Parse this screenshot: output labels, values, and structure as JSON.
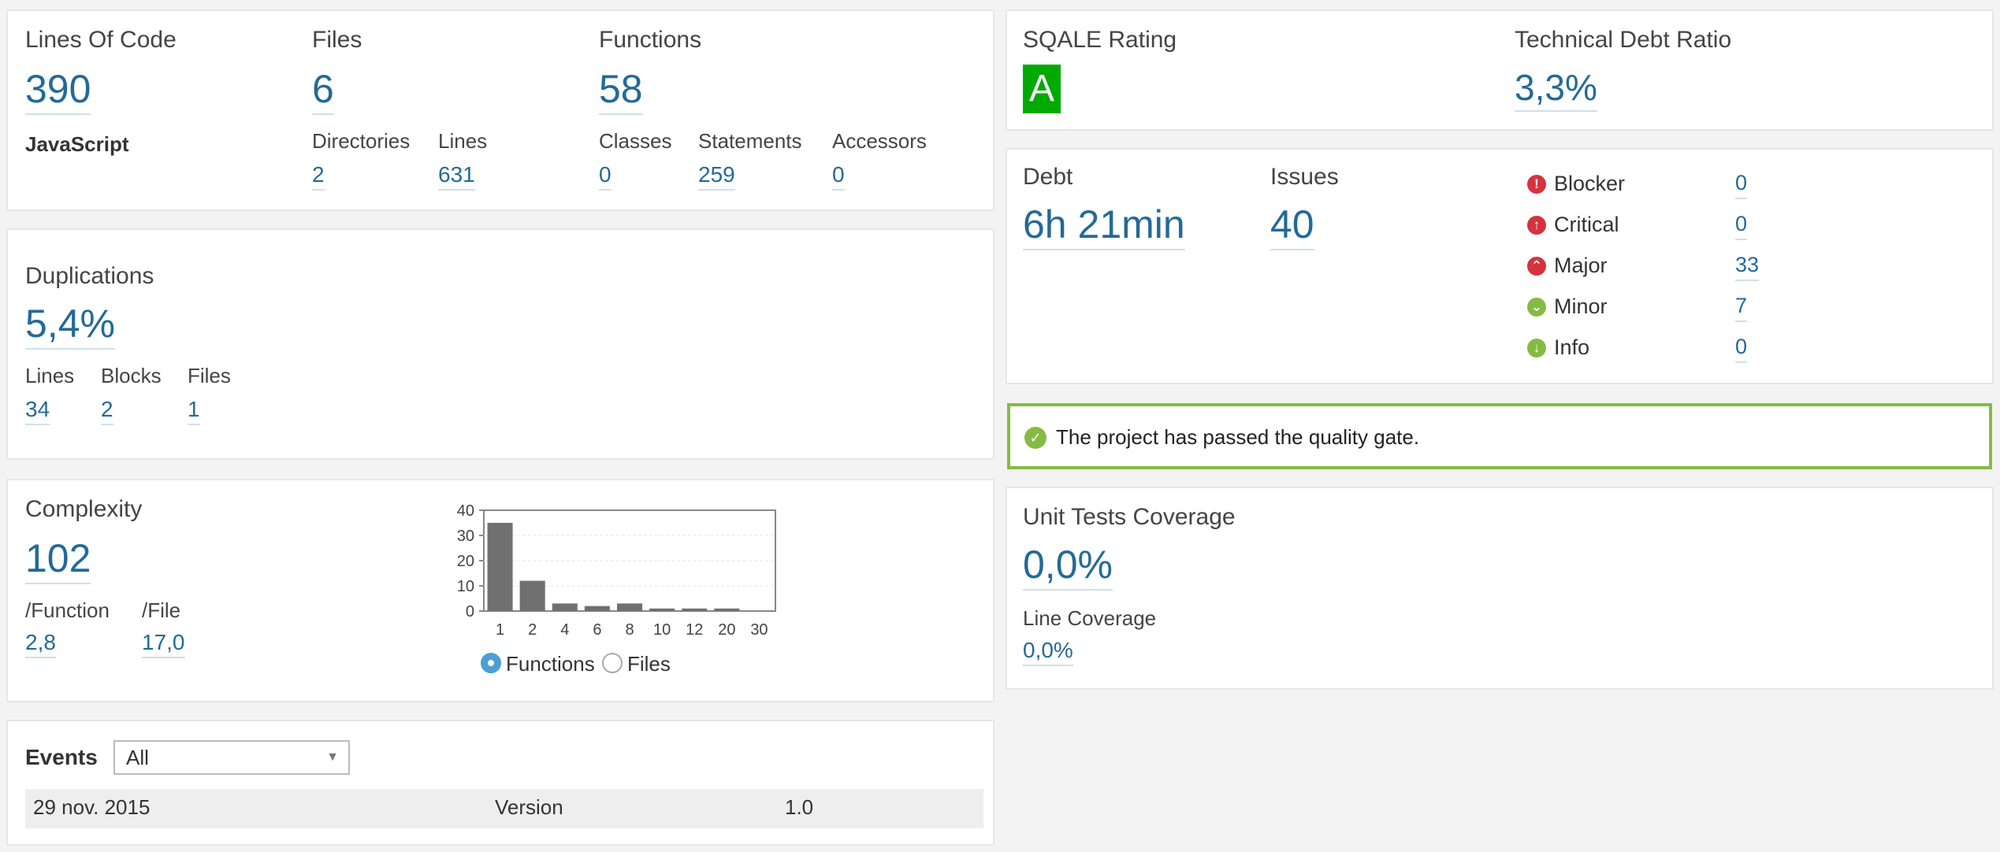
{
  "size": {
    "lines_of_code_label": "Lines Of Code",
    "lines_of_code_value": "390",
    "language": "JavaScript",
    "files_label": "Files",
    "files_value": "6",
    "directories_label": "Directories",
    "directories_value": "2",
    "lines_label": "Lines",
    "lines_value": "631",
    "functions_label": "Functions",
    "functions_value": "58",
    "classes_label": "Classes",
    "classes_value": "0",
    "statements_label": "Statements",
    "statements_value": "259",
    "accessors_label": "Accessors",
    "accessors_value": "0"
  },
  "duplications": {
    "title": "Duplications",
    "value": "5,4%",
    "lines_label": "Lines",
    "lines_value": "34",
    "blocks_label": "Blocks",
    "blocks_value": "2",
    "files_label": "Files",
    "files_value": "1"
  },
  "complexity": {
    "title": "Complexity",
    "value": "102",
    "per_function_label": "/Function",
    "per_function_value": "2,8",
    "per_file_label": "/File",
    "per_file_value": "17,0",
    "radio_functions": "Functions",
    "radio_files": "Files"
  },
  "chart_data": {
    "type": "bar",
    "categories": [
      "1",
      "2",
      "4",
      "6",
      "8",
      "10",
      "12",
      "20",
      "30"
    ],
    "values": [
      35,
      12,
      3,
      2,
      3,
      1,
      1,
      1,
      0
    ],
    "ylim": [
      0,
      40
    ],
    "yticks": [
      "0",
      "10",
      "20",
      "30",
      "40"
    ],
    "grid": true,
    "bar_color": "#707070"
  },
  "events": {
    "label": "Events",
    "filter_value": "All",
    "rows": [
      {
        "date": "29 nov. 2015",
        "type": "Version",
        "name": "1.0"
      }
    ]
  },
  "sqale": {
    "rating_label": "SQALE Rating",
    "rating_value": "A",
    "rating_color": "#00aa00",
    "ratio_label": "Technical Debt Ratio",
    "ratio_value": "3,3%"
  },
  "debt": {
    "debt_label": "Debt",
    "debt_value": "6h 21min",
    "issues_label": "Issues",
    "issues_value": "40",
    "severities": [
      {
        "name": "Blocker",
        "value": "0",
        "icon": "!",
        "color": "#d4333f"
      },
      {
        "name": "Critical",
        "value": "0",
        "icon": "↑",
        "color": "#d4333f"
      },
      {
        "name": "Major",
        "value": "33",
        "icon": "⌃",
        "color": "#d4333f"
      },
      {
        "name": "Minor",
        "value": "7",
        "icon": "⌄",
        "color": "#85bb43"
      },
      {
        "name": "Info",
        "value": "0",
        "icon": "↓",
        "color": "#85bb43"
      }
    ]
  },
  "quality_gate": {
    "message": "The project has passed the quality gate.",
    "color": "#85bb43"
  },
  "coverage": {
    "title": "Unit Tests Coverage",
    "value": "0,0%",
    "line_label": "Line Coverage",
    "line_value": "0,0%"
  }
}
